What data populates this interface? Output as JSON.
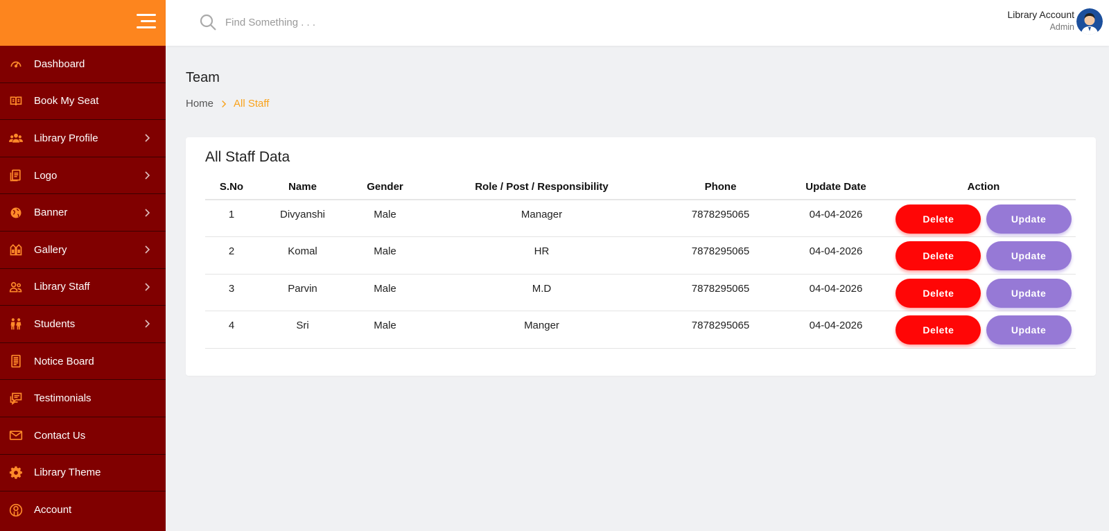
{
  "header": {
    "search_placeholder": "Find Something . . .",
    "account_name": "Library Account",
    "account_role": "Admin"
  },
  "sidebar": {
    "items": [
      {
        "label": "Dashboard",
        "icon": "speedometer-icon",
        "has_submenu": false
      },
      {
        "label": "Book My Seat",
        "icon": "book-icon",
        "has_submenu": false
      },
      {
        "label": "Library Profile",
        "icon": "users-icon",
        "has_submenu": true
      },
      {
        "label": "Logo",
        "icon": "document-icon",
        "has_submenu": true
      },
      {
        "label": "Banner",
        "icon": "globe-icon",
        "has_submenu": true
      },
      {
        "label": "Gallery",
        "icon": "gallery-icon",
        "has_submenu": true
      },
      {
        "label": "Library Staff",
        "icon": "staff-icon",
        "has_submenu": true
      },
      {
        "label": "Students",
        "icon": "students-icon",
        "has_submenu": true
      },
      {
        "label": "Notice Board",
        "icon": "notice-icon",
        "has_submenu": false
      },
      {
        "label": "Testimonials",
        "icon": "chat-icon",
        "has_submenu": false
      },
      {
        "label": "Contact Us",
        "icon": "mail-icon",
        "has_submenu": false
      },
      {
        "label": "Library Theme",
        "icon": "gear-icon",
        "has_submenu": false
      },
      {
        "label": "Account",
        "icon": "account-icon",
        "has_submenu": false
      }
    ]
  },
  "page": {
    "title": "Team",
    "breadcrumb_home": "Home",
    "breadcrumb_current": "All Staff"
  },
  "card": {
    "title": "All Staff Data",
    "columns": [
      "S.No",
      "Name",
      "Gender",
      "Role / Post / Responsibility",
      "Phone",
      "Update Date",
      "Action"
    ],
    "rows": [
      {
        "sno": "1",
        "name": "Divyanshi",
        "gender": "Male",
        "role": "Manager",
        "phone": "7878295065",
        "date": "04-04-2026"
      },
      {
        "sno": "2",
        "name": "Komal",
        "gender": "Male",
        "role": "HR",
        "phone": "7878295065",
        "date": "04-04-2026"
      },
      {
        "sno": "3",
        "name": "Parvin",
        "gender": "Male",
        "role": "M.D",
        "phone": "7878295065",
        "date": "04-04-2026"
      },
      {
        "sno": "4",
        "name": "Sri",
        "gender": "Male",
        "role": "Manger",
        "phone": "7878295065",
        "date": "04-04-2026"
      }
    ],
    "delete_label": "Delete",
    "update_label": "Update"
  },
  "colors": {
    "sidebar_bg": "#800000",
    "brand_bg": "#fd851e",
    "icon_orange": "#ff8a2a",
    "breadcrumb_active": "#f9a21a",
    "delete_button": "#ff0606",
    "update_button": "#9679d6"
  }
}
